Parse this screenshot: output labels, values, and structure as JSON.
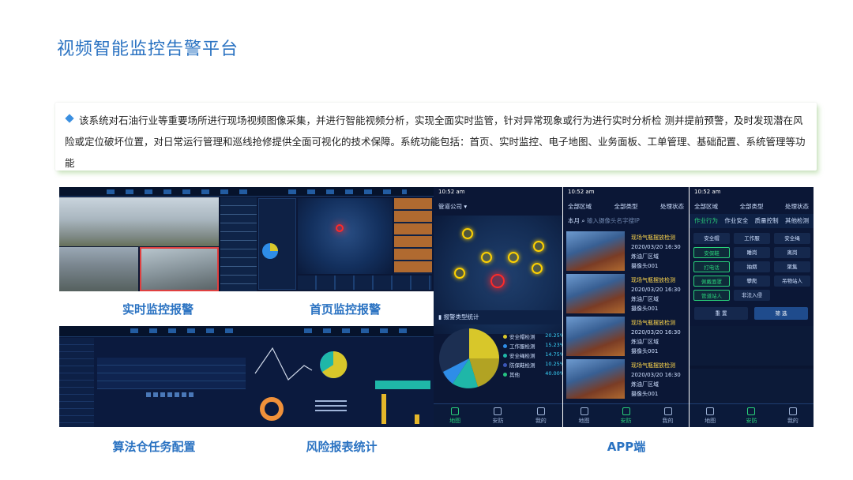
{
  "title": "视频智能监控告警平台",
  "description": "该系统对石油行业等重要场所进行现场视频图像采集，并进行智能视频分析，实现全面实时监管，针对异常现象或行为进行实时分析检 测并提前预警，及时发现潜在风险或定位破坏位置，对日常运行管理和巡线抢修提供全面可视化的技术保障。系统功能包括：首页、实时监控、电子地图、业务面板、工单管理、基础配置、系统管理等功能",
  "captions": {
    "realtime": "实时监控报警",
    "home": "首页监控报警",
    "algo": "算法仓任务配置",
    "risk": "风险报表统计",
    "app": "APP端"
  },
  "app": {
    "time": "10:52 am",
    "company": "管道公司",
    "stats_title": "报警类型统计",
    "legend": [
      {
        "label": "安全帽检测",
        "pct": "20.25%",
        "color": "#d8c72a"
      },
      {
        "label": "工作服检测",
        "pct": "15.23%",
        "color": "#2e8de8"
      },
      {
        "label": "安全绳检测",
        "pct": "14.75%",
        "color": "#1fb7a8"
      },
      {
        "label": "防保鞋检测",
        "pct": "10.25%",
        "color": "#3a56b8"
      },
      {
        "label": "其他",
        "pct": "40.00%",
        "color": "#26c281"
      }
    ],
    "tabs": [
      "地图",
      "安防",
      "我的"
    ],
    "filters": [
      "全部区域",
      "全部类型",
      "处理状态"
    ],
    "month": "本月",
    "search_placeholder": "输入摄像头名字搜IP",
    "alarms": [
      {
        "title": "现场气瓶摆放检测",
        "time": "2020/03/20 16:30",
        "area": "炼油厂区域",
        "camera": "摄像头001"
      },
      {
        "title": "现场气瓶摆放检测",
        "time": "2020/03/20 16:30",
        "area": "炼油厂区域",
        "camera": "摄像头001"
      },
      {
        "title": "现场气瓶摆放检测",
        "time": "2020/03/20 16:30",
        "area": "炼油厂区域",
        "camera": "摄像头001"
      },
      {
        "title": "现场气瓶摆放检测",
        "time": "2020/03/20 16:30",
        "area": "炼油厂区域",
        "camera": "摄像头001"
      }
    ],
    "filter_tabs": [
      "作业行为",
      "作业安全",
      "质量控制",
      "其他检测"
    ],
    "chips": [
      "安全帽",
      "工作服",
      "安全绳",
      "安保鞋",
      "睡岗",
      "离岗",
      "打电话",
      "抽烟",
      "聚集",
      "佩戴面罩",
      "攀爬",
      "吊物站人",
      "管道站人",
      "非法入侵"
    ],
    "chips_on": [
      3,
      6,
      9,
      12
    ],
    "reset": "重 置",
    "filter": "筛 选"
  }
}
